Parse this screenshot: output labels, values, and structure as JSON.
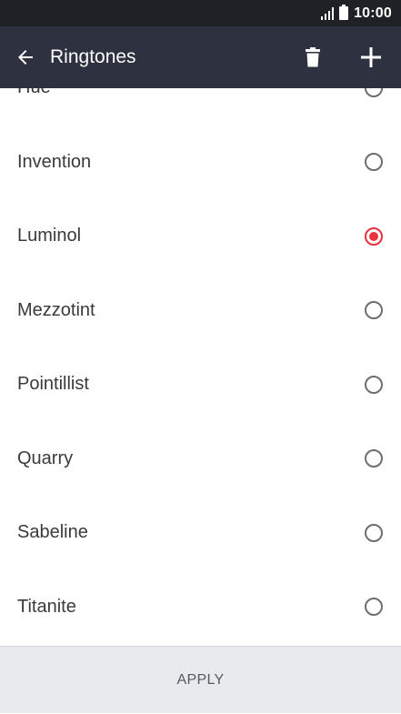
{
  "status_bar": {
    "time": "10:00",
    "icons": [
      "signal-icon",
      "battery-icon"
    ]
  },
  "app_bar": {
    "title": "Ringtones",
    "back_icon": "arrow-left-icon",
    "delete_icon": "trash-icon",
    "add_icon": "plus-icon"
  },
  "ringtones": [
    {
      "label": "Hue",
      "selected": false
    },
    {
      "label": "Invention",
      "selected": false
    },
    {
      "label": "Luminol",
      "selected": true
    },
    {
      "label": "Mezzotint",
      "selected": false
    },
    {
      "label": "Pointillist",
      "selected": false
    },
    {
      "label": "Quarry",
      "selected": false
    },
    {
      "label": "Sabeline",
      "selected": false
    },
    {
      "label": "Titanite",
      "selected": false
    }
  ],
  "footer": {
    "apply_label": "APPLY"
  },
  "colors": {
    "app_bar": "#2e3140",
    "status_bar": "#1f2126",
    "accent": "#e8323c",
    "footer": "#e8eaee"
  }
}
